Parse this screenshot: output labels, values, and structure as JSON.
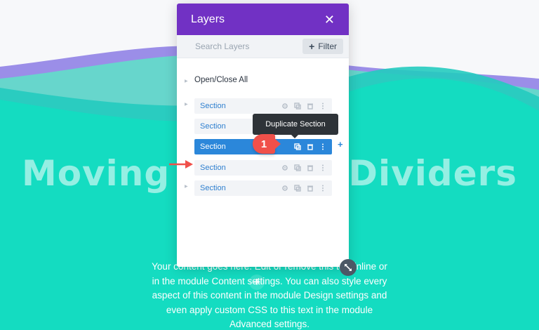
{
  "colors": {
    "hero_bg": "#14dcc1",
    "wave_purple": "#9b8ee8",
    "wave_teal": "#67d6cc",
    "panel_header": "#7131c4",
    "active_row": "#2b87da",
    "tooltip_bg": "#2e3338",
    "badge": "#f0504a"
  },
  "hero": {
    "title": "Moving Section Dividers",
    "body": "Your content goes here. Edit or remove this text inline or in the module Content settings. You can also style every aspect of this content in the module Design settings and even apply custom CSS to this text in the module Advanced settings."
  },
  "layers_panel": {
    "title": "Layers",
    "close_icon": "close-icon",
    "search_placeholder": "Search Layers",
    "filter_label": "Filter",
    "open_close_label": "Open/Close All",
    "rows": [
      {
        "label": "Section",
        "state": "normal"
      },
      {
        "label": "Section",
        "state": "normal"
      },
      {
        "label": "Section",
        "state": "active"
      },
      {
        "label": "Section",
        "state": "normal"
      },
      {
        "label": "Section",
        "state": "normal"
      }
    ],
    "row_icons": [
      "gear-icon",
      "duplicate-icon",
      "trash-icon",
      "more-icon"
    ]
  },
  "tooltip": {
    "text": "Duplicate Section"
  },
  "step_badge": {
    "number": "1"
  },
  "add_after_label": "+",
  "add_module_label": "+"
}
